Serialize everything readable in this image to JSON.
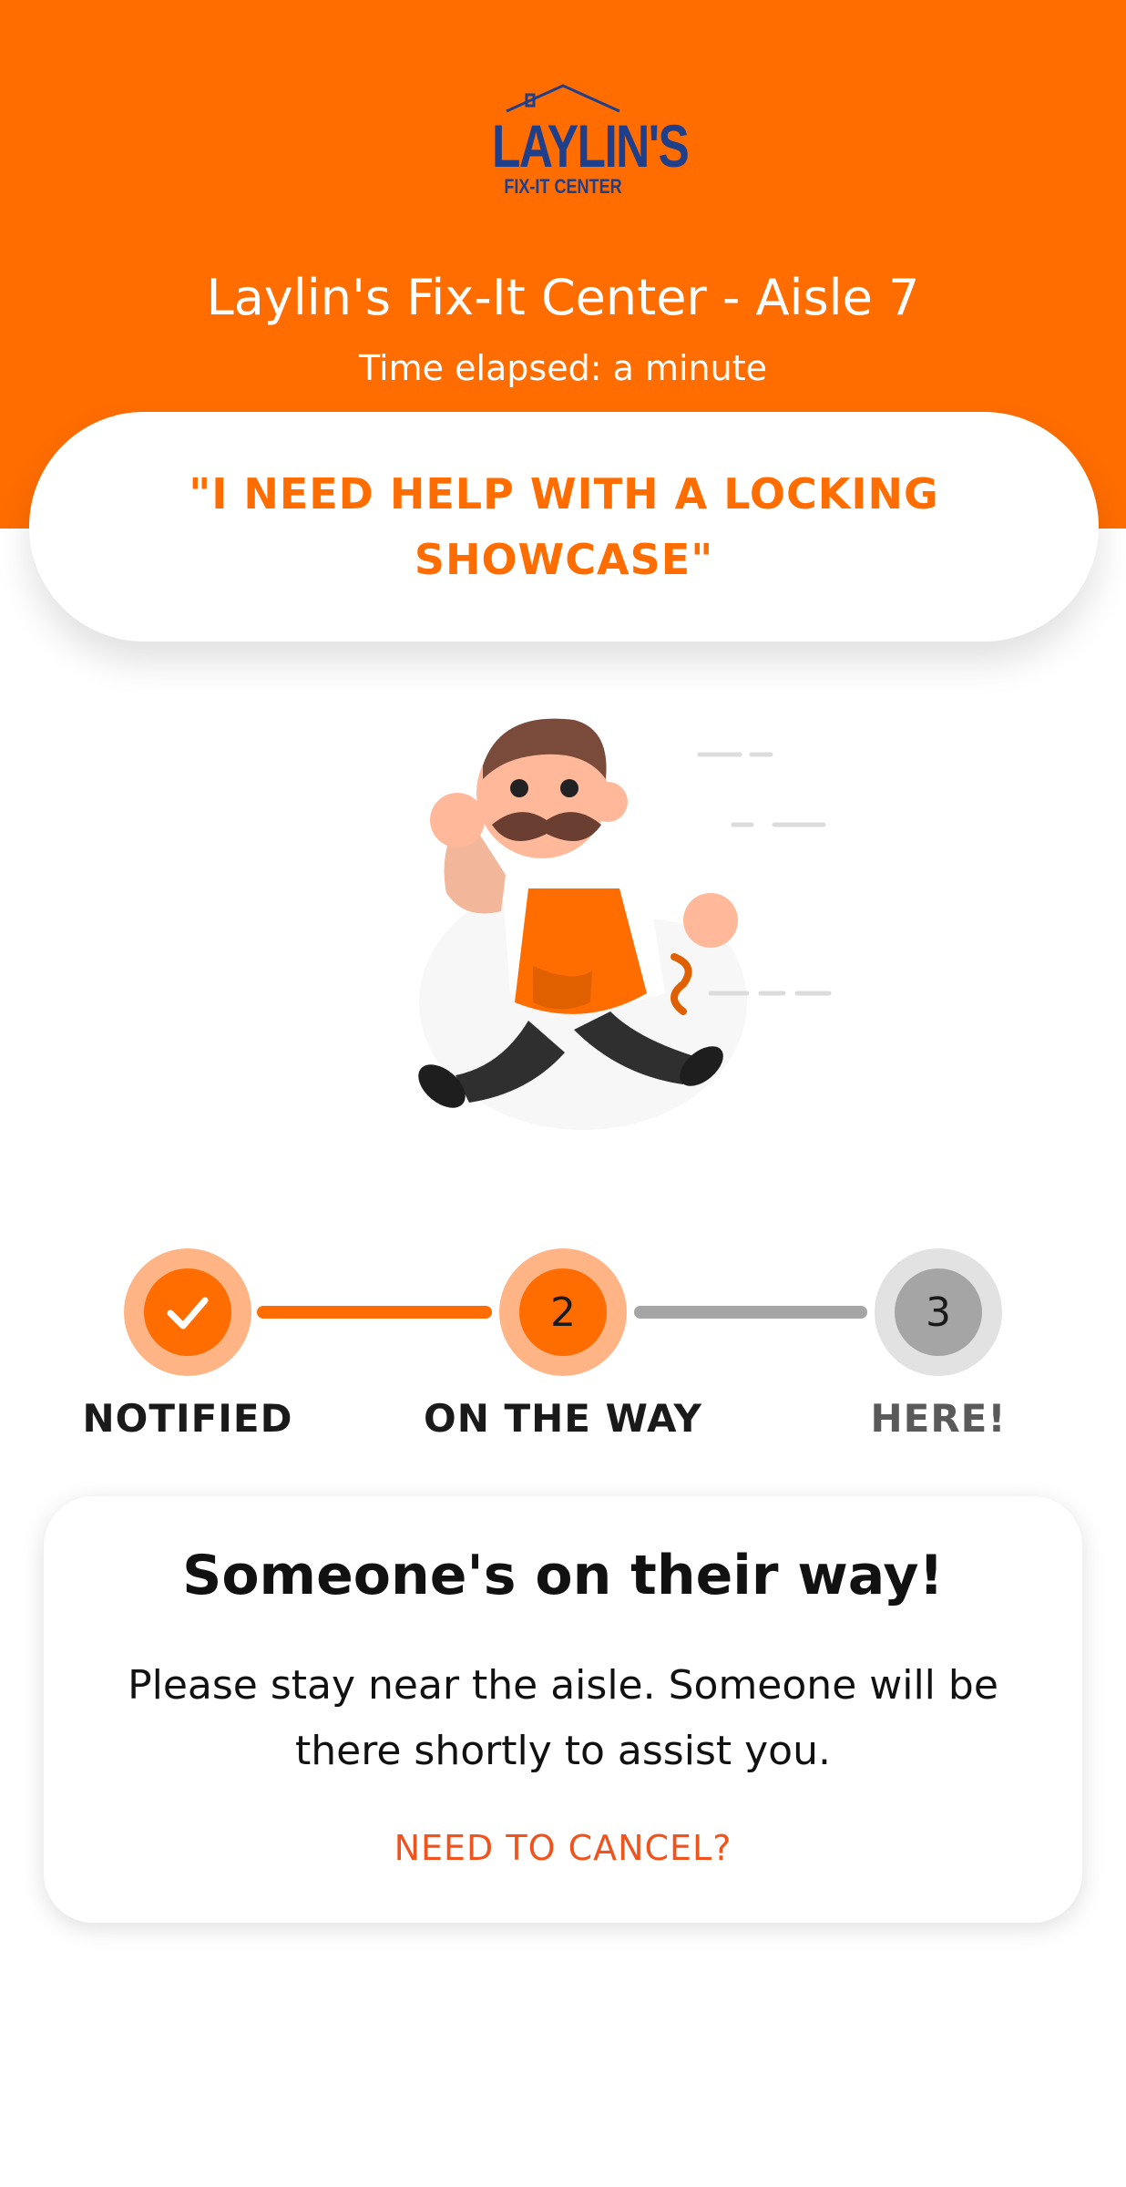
{
  "brand": {
    "logo_word": "LAYLIN'S",
    "logo_sub": "FIX-IT CENTER",
    "primary_color": "#FF6D00",
    "logo_color": "#1F3F8A"
  },
  "header": {
    "store_title": "Laylin's Fix-It Center - Aisle 7",
    "elapsed": "Time elapsed: a minute"
  },
  "request": {
    "text": "\"I NEED HELP WITH A LOCKING SHOWCASE\""
  },
  "mascot": {
    "icon": "running-store-associate-illustration"
  },
  "progress": {
    "steps": [
      {
        "label": "NOTIFIED",
        "number": "",
        "state": "done",
        "icon": "check-icon"
      },
      {
        "label": "ON THE WAY",
        "number": "2",
        "state": "active"
      },
      {
        "label": "HERE!",
        "number": "3",
        "state": "pending"
      }
    ],
    "done_color": "#FF6D00",
    "pending_color": "#A5A5A5"
  },
  "status_card": {
    "title": "Someone's on their way!",
    "body": "Please stay near the aisle. Someone will be there shortly to assist you.",
    "cancel_label": "NEED TO CANCEL?",
    "cancel_color": "#F0541E"
  }
}
